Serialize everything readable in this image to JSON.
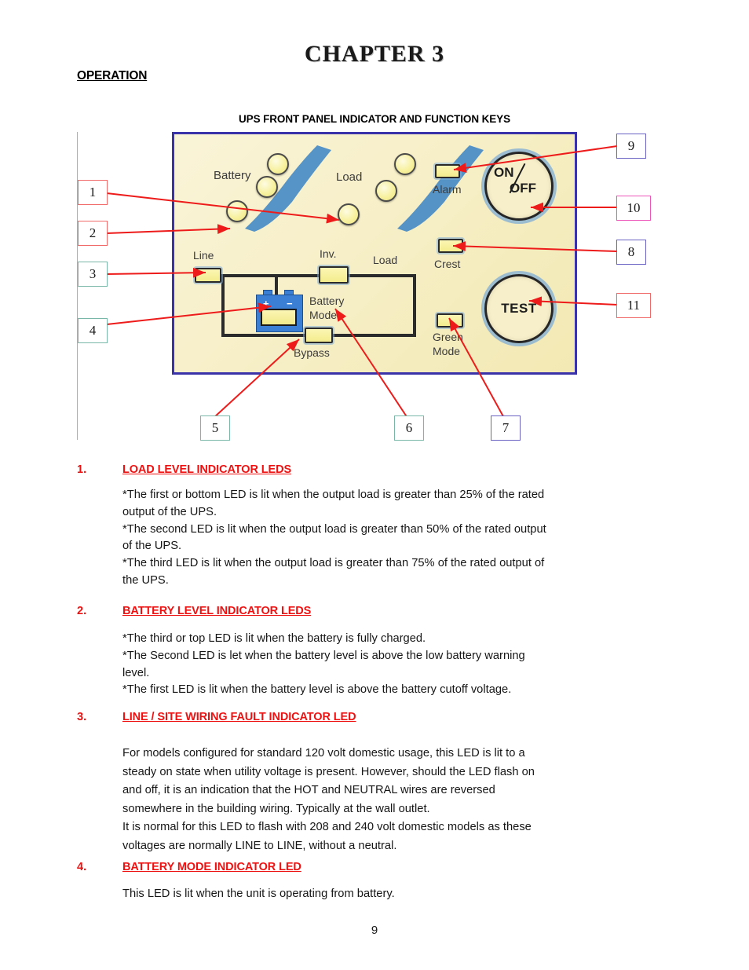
{
  "header": {
    "chapter_title": "CHAPTER 3",
    "operation_heading": "OPERATION",
    "figure_caption": "UPS FRONT PANEL INDICATOR AND FUNCTION KEYS"
  },
  "panel": {
    "labels": {
      "battery": "Battery",
      "load_top": "Load",
      "alarm": "Alarm",
      "line": "Line",
      "inv": "Inv.",
      "load_circuit": "Load",
      "crest": "Crest",
      "battery_mode_l1": "Battery",
      "battery_mode_l2": "Mode",
      "green_mode_l1": "Green",
      "green_mode_l2": "Mode",
      "bypass": "Bypass",
      "battery_plus": "+",
      "battery_minus": "−"
    },
    "buttons": {
      "on": "ON",
      "off": "OFF",
      "test": "TEST"
    },
    "colors": {
      "panel_background": "#f7efc9",
      "panel_border": "#3a32a8",
      "led_yellow": "#f4ec8d",
      "swoosh_blue": "#3f86c6",
      "battery_blue": "#3b7fd4",
      "leader_red": "#ee1b1b"
    }
  },
  "callouts": [
    {
      "number": "1",
      "color": "#f06a6a",
      "target": "load-bottom-led"
    },
    {
      "number": "2",
      "color": "#f06a6a",
      "target": "battery-bottom-led"
    },
    {
      "number": "3",
      "color": "#79b8a8",
      "target": "line-led"
    },
    {
      "number": "4",
      "color": "#79b8a8",
      "target": "battery-mode-led"
    },
    {
      "number": "5",
      "color": "#79b8a8",
      "target": "bypass-led"
    },
    {
      "number": "6",
      "color": "#79b8a8",
      "target": "inverter-led"
    },
    {
      "number": "7",
      "color": "#6a63c4",
      "target": "green-mode-led"
    },
    {
      "number": "8",
      "color": "#6a63c4",
      "target": "crest-led"
    },
    {
      "number": "9",
      "color": "#6a63c4",
      "target": "alarm-led"
    },
    {
      "number": "10",
      "color": "#ee55bb",
      "target": "on-off-button"
    },
    {
      "number": "11",
      "color": "#f06a6a",
      "target": "test-button"
    }
  ],
  "sections": [
    {
      "number": "1.",
      "title": "LOAD LEVEL INDICATOR LEDS",
      "body": "*The first or bottom LED is lit when the output load is greater than 25% of the rated\n output of the UPS.\n*The second LED is lit when the output load is greater than 50% of the rated output\n of the UPS.\n*The third LED is lit when the output load is greater than 75% of the rated output of\n the UPS."
    },
    {
      "number": "2.",
      "title": "BATTERY LEVEL INDICATOR LEDS",
      "body": "*The third or top LED is lit when the battery is fully charged.\n*The Second LED is let when the battery level is above the low battery warning\n  level.\n*The first LED is lit when the battery level is above the battery cutoff voltage."
    },
    {
      "number": "3.",
      "title": "LINE / SITE WIRING FAULT INDICATOR LED",
      "body": "For models configured for standard 120 volt domestic usage, this LED is lit to a\nsteady on state when utility voltage is present. However, should the LED flash on\nand off, it is an indication that the HOT and NEUTRAL wires are reversed\nsomewhere in the building wiring. Typically at the wall outlet.\nIt is normal for this LED to flash with 208 and 240 volt domestic models as these\nvoltages are normally LINE to LINE, without a neutral."
    },
    {
      "number": "4.",
      "title": "BATTERY MODE INDICATOR LED",
      "body": "This LED is lit when the unit is operating from battery."
    }
  ],
  "footer": {
    "page_number": "9"
  }
}
